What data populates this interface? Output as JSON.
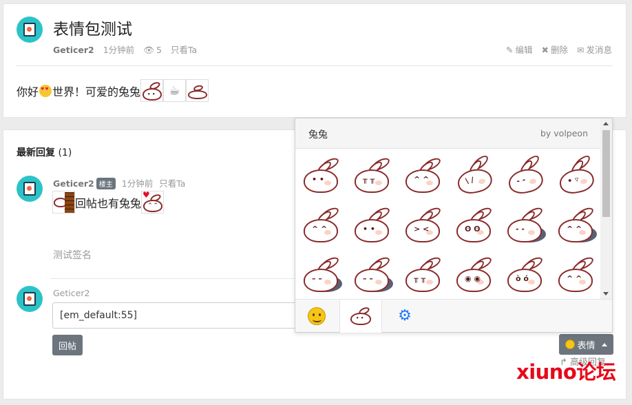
{
  "thread": {
    "title": "表情包测试",
    "author": "Geticer2",
    "time": "1分钟前",
    "views": "5",
    "only_author": "只看Ta",
    "actions": {
      "edit": "编辑",
      "delete": "删除",
      "message": "发消息"
    },
    "content_parts": [
      "你好",
      "世界！可爱的兔兔"
    ]
  },
  "replies": {
    "title": "最新回复",
    "count": "(1)",
    "items": [
      {
        "author": "Geticer2",
        "badge": "楼主",
        "time": "1分钟前",
        "only_author": "只看Ta",
        "content_text": "回帖也有兔兔",
        "signature": "测试签名"
      }
    ]
  },
  "reply_form": {
    "author": "Geticer2",
    "input_value": "[em_default:55]",
    "submit_label": "回帖",
    "emoji_button_label": "表情",
    "advanced_label": "高级回复"
  },
  "emoji_panel": {
    "pack_name": "兔兔",
    "pack_author": "by volpeon",
    "faces": [
      "• •",
      "╥ ╥",
      "^ ^",
      "\\ /",
      "- -",
      "• ▿",
      "^ ^",
      "• •",
      "> <",
      "ʘ ʘ",
      "- -",
      "^ ^",
      "– –",
      "– –",
      "╥ ╥",
      "◉ ◉",
      "ò ó",
      "^ ^"
    ],
    "tabs": [
      "default-emoji",
      "bunny-pack",
      "settings"
    ]
  },
  "watermark": "xiuno论坛",
  "colors": {
    "avatar": "#2cc3c8",
    "button": "#6c757d",
    "settings_icon": "#1e7cf0",
    "watermark": "#e8071a"
  }
}
